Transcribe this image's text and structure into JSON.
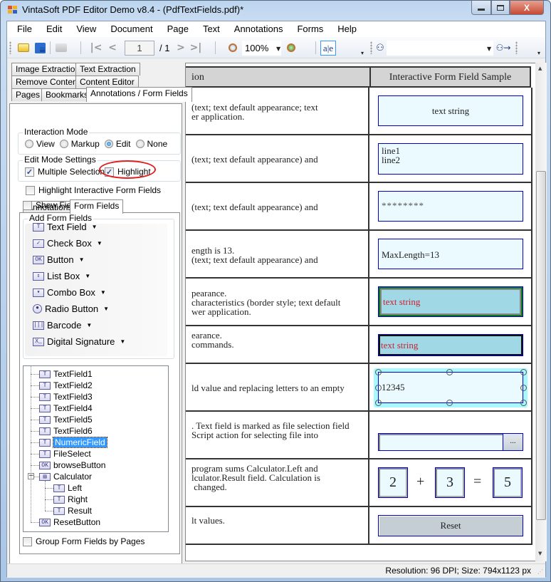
{
  "window": {
    "title": "VintaSoft PDF Editor Demo v8.4 -  (PdfTextFields.pdf)*",
    "minimize_label": "—",
    "maximize_label": "□",
    "close_label": "X"
  },
  "menu": [
    "File",
    "Edit",
    "View",
    "Document",
    "Page",
    "Text",
    "Annotations",
    "Forms",
    "Help"
  ],
  "toolbar": {
    "page_current": "1",
    "page_total": "/ 1",
    "zoom_value": "100%",
    "text_select_label": "a|e",
    "search_value": ""
  },
  "left_panel": {
    "tabs_row1": [
      "Image Extraction",
      "Text Extraction"
    ],
    "tabs_row2": [
      "Remove Content",
      "Content Editor"
    ],
    "tabs_row3": [
      "Pages",
      "Bookmarks",
      "Annotations / Form Fields"
    ],
    "active_tab": "Annotations / Form Fields",
    "interaction_mode": {
      "title": "Interaction Mode",
      "options": [
        "View",
        "Markup",
        "Edit",
        "None"
      ],
      "selected": "Edit"
    },
    "edit_mode_settings": {
      "title": "Edit Mode Settings",
      "multiple_selection": {
        "label": "Multiple Selection",
        "checked": true
      },
      "highlight": {
        "label": "Highlight",
        "checked": true
      }
    },
    "highlight_interactive": {
      "label": "Highlight Interactive Form  Fields",
      "checked": false
    },
    "sub_tabs": [
      "Annotations",
      "Form Fields"
    ],
    "active_sub_tab": "Form Fields",
    "show_field_names": {
      "label": "Show Field Names",
      "checked": false
    },
    "add_form_fields": {
      "title": "Add Form Fields",
      "items": [
        {
          "label": "Text Field",
          "icon": "text-field-icon",
          "glyph": "T"
        },
        {
          "label": "Check Box",
          "icon": "check-box-icon",
          "glyph": "✓"
        },
        {
          "label": "Button",
          "icon": "button-icon",
          "glyph": "OK"
        },
        {
          "label": "List Box",
          "icon": "list-box-icon",
          "glyph": "⇕"
        },
        {
          "label": "Combo Box",
          "icon": "combo-box-icon",
          "glyph": "▾"
        },
        {
          "label": "Radio Button",
          "icon": "radio-button-icon",
          "glyph": "●"
        },
        {
          "label": "Barcode",
          "icon": "barcode-icon",
          "glyph": "|||"
        },
        {
          "label": "Digital Signature",
          "icon": "digital-signature-icon",
          "glyph": "X_"
        }
      ]
    },
    "tree": [
      {
        "label": "TextField1",
        "glyph": "T",
        "level": 0
      },
      {
        "label": "TextField2",
        "glyph": "T",
        "level": 0
      },
      {
        "label": "TextField3",
        "glyph": "T",
        "level": 0
      },
      {
        "label": "TextField4",
        "glyph": "T",
        "level": 0
      },
      {
        "label": "TextField5",
        "glyph": "T",
        "level": 0
      },
      {
        "label": "TextField6",
        "glyph": "T",
        "level": 0
      },
      {
        "label": "NumericField",
        "glyph": "T",
        "level": 0,
        "selected": true
      },
      {
        "label": "FileSelect",
        "glyph": "T",
        "level": 0
      },
      {
        "label": "browseButton",
        "glyph": "OK",
        "level": 0
      },
      {
        "label": "Calculator",
        "glyph": "▤",
        "level": 0,
        "expanded": true
      },
      {
        "label": "Left",
        "glyph": "T",
        "level": 1
      },
      {
        "label": "Right",
        "glyph": "T",
        "level": 1
      },
      {
        "label": "Result",
        "glyph": "T",
        "level": 1
      },
      {
        "label": "ResetButton",
        "glyph": "OK",
        "level": 0
      }
    ],
    "group_by_pages": {
      "label": "Group Form Fields by Pages",
      "checked": false
    }
  },
  "document": {
    "header_left": "ion",
    "header_right": "Interactive Form Field Sample",
    "rows": [
      {
        "desc": "(text; text default appearance; text\ner application.",
        "field": "text string"
      },
      {
        "desc": "(text; text default appearance) and",
        "field": "line1\nline2"
      },
      {
        "desc": "(text; text default appearance) and",
        "field": "********"
      },
      {
        "desc": "ength is 13.\n(text; text default appearance) and",
        "field": "MaxLength=13"
      },
      {
        "desc": "pearance.\ncharacteristics (border style; text default\nwer application.",
        "field": "text string"
      },
      {
        "desc": "earance.\ncommands.",
        "field": "text string"
      },
      {
        "desc": "ld value and replacing letters to an empty",
        "field": "12345"
      },
      {
        "desc": ". Text field is marked as file selection field\nScript action for selecting file into",
        "field": "",
        "browse": "..."
      },
      {
        "desc": "program sums Calculator.Left and\nlculator.Result field. Calculation is\n changed.",
        "calc": {
          "left": "2",
          "op": "+",
          "right": "3",
          "eq": "=",
          "result": "5"
        }
      },
      {
        "desc": "lt values.",
        "button": "Reset"
      }
    ]
  },
  "status": {
    "text": "Resolution: 96 DPI; Size: 794x1123 px"
  },
  "colors": {
    "field_bg": "#eafaff",
    "field_border": "#0000cc",
    "red_text": "#cc2233",
    "selected_bg": "#3399ff",
    "highlight_oval": "#e02020"
  }
}
